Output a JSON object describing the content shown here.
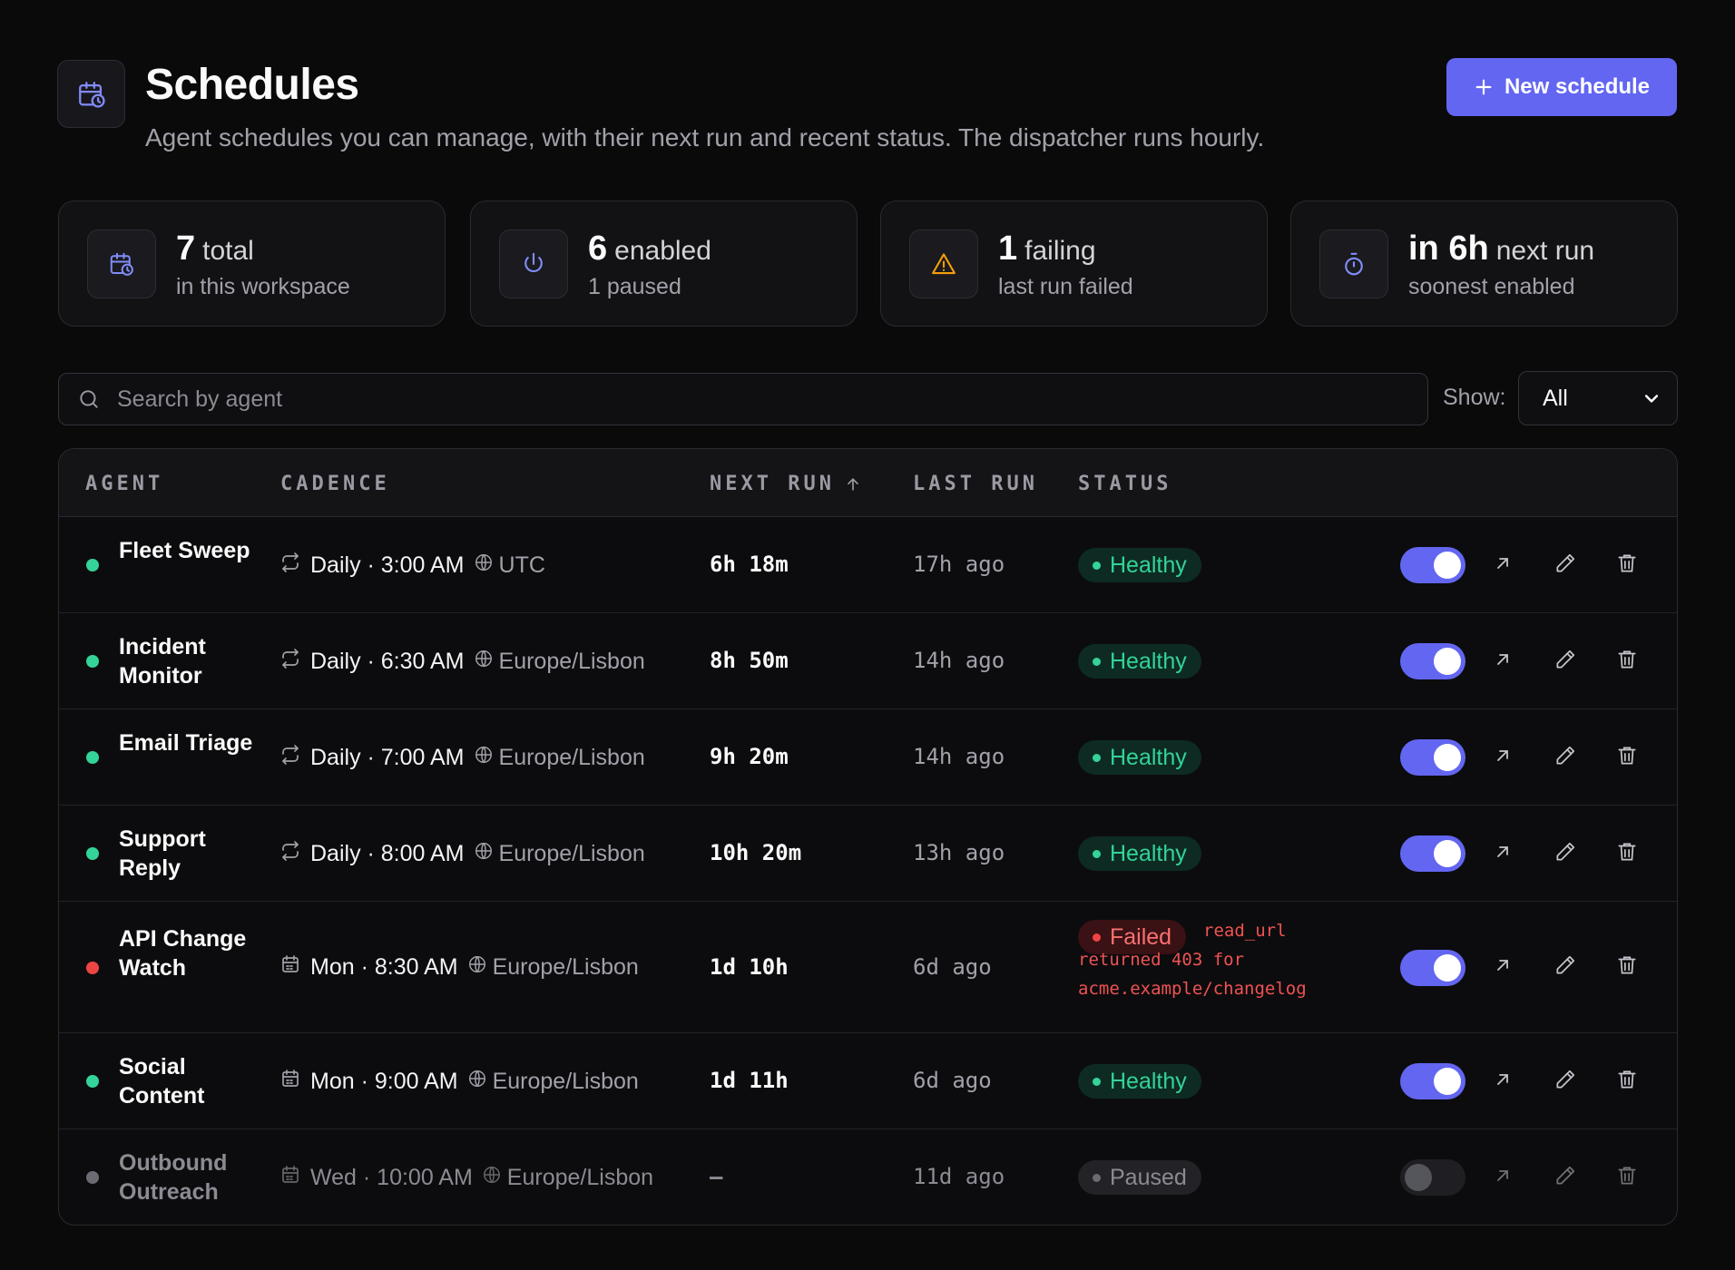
{
  "header": {
    "title": "Schedules",
    "subtitle": "Agent schedules you can manage, with their next run and recent status. The dispatcher runs hourly.",
    "icon": "calendar-clock-icon",
    "new_button_label": "New schedule"
  },
  "stats": [
    {
      "value": "7",
      "word": "total",
      "sub": "in this workspace",
      "icon": "calendar-clock-icon"
    },
    {
      "value": "6",
      "word": "enabled",
      "sub": "1 paused",
      "icon": "power-icon"
    },
    {
      "value": "1",
      "word": "failing",
      "sub": "last run failed",
      "icon": "warning-icon"
    },
    {
      "value": "in 6h",
      "word": "next run",
      "sub": "soonest enabled",
      "icon": "timer-icon"
    }
  ],
  "filters": {
    "search_placeholder": "Search by agent",
    "show_label": "Show:",
    "show_value": "All"
  },
  "table": {
    "columns": [
      "AGENT",
      "CADENCE",
      "NEXT RUN",
      "LAST RUN",
      "STATUS"
    ],
    "rows": [
      {
        "agent": "Fleet Sweep",
        "cadence": "Daily · 3:00 AM",
        "tz": "UTC",
        "next": "6h 18m",
        "last": "17h ago",
        "status": "Healthy",
        "enabled": true
      },
      {
        "agent": "Incident Monitor",
        "cadence": "Daily · 6:30 AM",
        "tz": "Europe/Lisbon",
        "next": "8h 50m",
        "last": "14h ago",
        "status": "Healthy",
        "enabled": true
      },
      {
        "agent": "Email Triage",
        "cadence": "Daily · 7:00 AM",
        "tz": "Europe/Lisbon",
        "next": "9h 20m",
        "last": "14h ago",
        "status": "Healthy",
        "enabled": true
      },
      {
        "agent": "Support Reply",
        "cadence": "Daily · 8:00 AM",
        "tz": "Europe/Lisbon",
        "next": "10h 20m",
        "last": "13h ago",
        "status": "Healthy",
        "enabled": true
      },
      {
        "agent": "API Change Watch",
        "cadence": "Mon · 8:30 AM",
        "tz": "Europe/Lisbon",
        "next": "1d 10h",
        "last": "6d ago",
        "status": "Failed",
        "error": "read_url returned 403 for acme.example/changelog",
        "enabled": true
      },
      {
        "agent": "Social Content",
        "cadence": "Mon · 9:00 AM",
        "tz": "Europe/Lisbon",
        "next": "1d 11h",
        "last": "6d ago",
        "status": "Healthy",
        "enabled": true
      },
      {
        "agent": "Outbound Outreach",
        "cadence": "Wed · 10:00 AM",
        "tz": "Europe/Lisbon",
        "next": "—",
        "last": "11d ago",
        "status": "Paused",
        "enabled": false
      }
    ]
  },
  "colors": {
    "accent": "#6366f1",
    "healthy": "#34d399",
    "failed": "#ef4444",
    "warning": "#f59e0b",
    "background": "#0a0a0b"
  }
}
